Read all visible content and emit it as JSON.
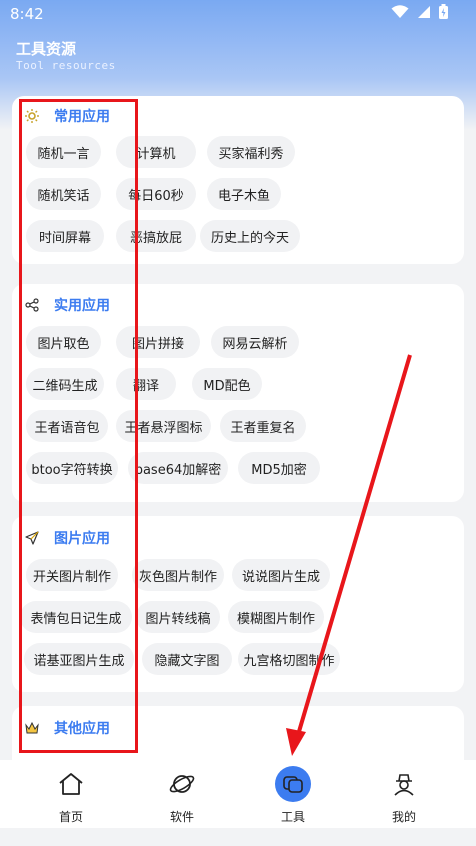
{
  "status": {
    "time": "8:42"
  },
  "header": {
    "title": "工具资源",
    "subtitle": "Tool resources"
  },
  "sections": [
    {
      "title": "常用应用",
      "icon": "sun-icon",
      "items": [
        "随机一言",
        "计算机",
        "买家福利秀",
        "随机笑话",
        "每日60秒",
        "电子木鱼",
        "时间屏幕",
        "恶搞放屁",
        "历史上的今天"
      ]
    },
    {
      "title": "实用应用",
      "icon": "share-icon",
      "items": [
        "图片取色",
        "图片拼接",
        "网易云解析",
        "二维码生成",
        "翻译",
        "MD配色",
        "王者语音包",
        "王者悬浮图标",
        "王者重复名",
        "btoo字符转换",
        "base64加解密",
        "MD5加密"
      ]
    },
    {
      "title": "图片应用",
      "icon": "send-icon",
      "items": [
        "开关图片制作",
        "灰色图片制作",
        "说说图片生成",
        "表情包日记生成",
        "图片转线稿",
        "模糊图片制作",
        "诺基亚图片生成",
        "隐藏文字图",
        "九宫格切图制作"
      ]
    },
    {
      "title": "其他应用",
      "icon": "crown-icon",
      "items": []
    }
  ],
  "nav": [
    {
      "label": "首页",
      "icon": "home-icon"
    },
    {
      "label": "软件",
      "icon": "planet-icon"
    },
    {
      "label": "工具",
      "icon": "tools-icon",
      "active": true
    },
    {
      "label": "我的",
      "icon": "user-icon"
    }
  ],
  "colors": {
    "accent": "#3c7cf0",
    "highlight": "#e8161b",
    "header": "#7aa9f2"
  }
}
